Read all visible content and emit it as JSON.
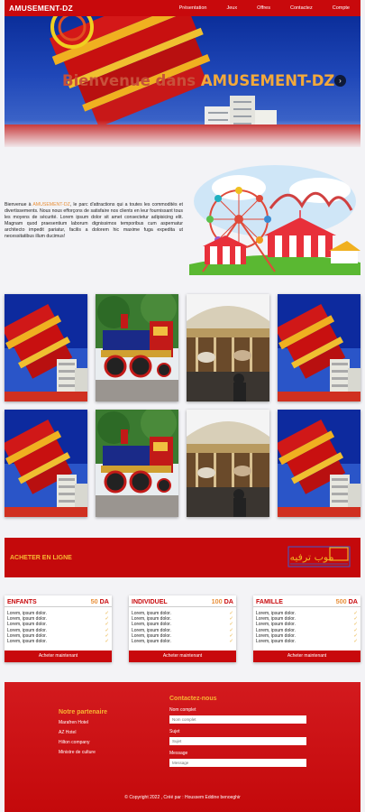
{
  "nav": {
    "brand": "AMUSEMENT-DZ",
    "items": [
      "Présentation",
      "Jeux",
      "Offres",
      "Contactez",
      "Compte"
    ]
  },
  "hero": {
    "title_part1": "Bienvenue dans ",
    "title_part2": "AMUSEMENT-DZ",
    "next_icon": "›"
  },
  "about": {
    "text_before": "Bienvenue à ",
    "highlight": "AMUSEMENT-DZ",
    "text_after": ", le parc d'attractions qui a toutes les commodités et divertissements. Nous nous efforçons de satisfaire nos clients en leur fournissant tous les moyens de sécurité. Lorem ipsum dolor sit amet consectetur adipisicing elit. Magnam quod praesentium laborum dignissimos temporibus cum aspernatur architecto impedit pariatur, facilis a dolorem hic maxime fuga expedita ut necessitatibus illum ducimus!"
  },
  "banner": {
    "title": "ACHETER EN LIGNE",
    "logo_text": "موب ترفيه"
  },
  "pricing": [
    {
      "name": "ENFANTS",
      "price": "50",
      "currency": "DA",
      "items": [
        "Lorem, ipsum dolor.",
        "Lorem, ipsum dolor.",
        "Lorem, ipsum dolor.",
        "Lorem, ipsum dolor.",
        "Lorem, ipsum dolor.",
        "Lorem, ipsum dolor."
      ],
      "button": "Acheter maintenant"
    },
    {
      "name": "INDIVIDUEL",
      "price": "100",
      "currency": "DA",
      "items": [
        "Lorem, ipsum dolor.",
        "Lorem, ipsum dolor.",
        "Lorem, ipsum dolor.",
        "Lorem, ipsum dolor.",
        "Lorem, ipsum dolor.",
        "Lorem, ipsum dolor."
      ],
      "button": "Acheter maintenant"
    },
    {
      "name": "FAMILLE",
      "price": "500",
      "currency": "DA",
      "items": [
        "Lorem, ipsum dolor.",
        "Lorem, ipsum dolor.",
        "Lorem, ipsum dolor.",
        "Lorem, ipsum dolor.",
        "Lorem, ipsum dolor.",
        "Lorem, ipsum dolor."
      ],
      "button": "Acheter maintenant"
    }
  ],
  "footer": {
    "partner_title": "Notre partenaire",
    "partners": [
      "Marafren Hotel",
      "AZ Hotel",
      "Hilton company",
      "Ministre de culture"
    ],
    "contact_title": "Contactez-nous",
    "fields": [
      {
        "label": "Nom complet",
        "placeholder": "Nom complet"
      },
      {
        "label": "Sujet",
        "placeholder": "Sujet"
      },
      {
        "label": "Message",
        "placeholder": "Message"
      }
    ],
    "copyright": "© Copyright 2022 , Créé par : Houssem Eddine benoeghir"
  },
  "colors": {
    "primary": "#c8090c",
    "accent": "#f7b733",
    "highlight": "#e8903a"
  }
}
